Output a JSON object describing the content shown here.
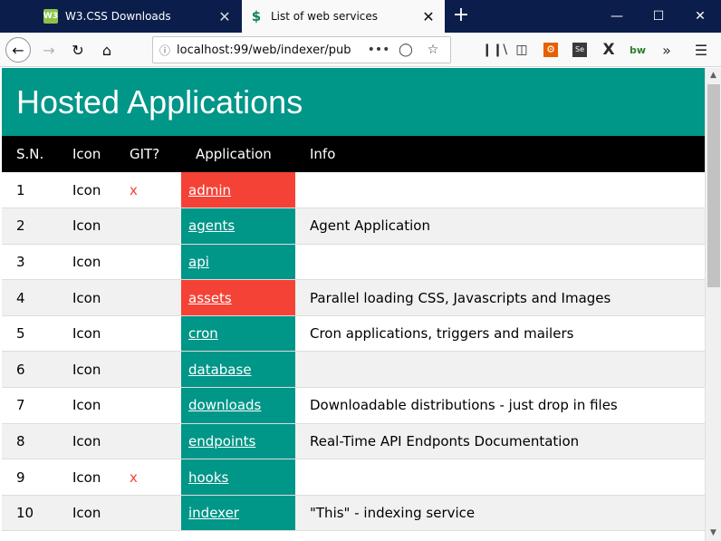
{
  "tabs": [
    {
      "title": "W3.CSS Downloads",
      "icon": "w3css-favicon-icon",
      "icon_text": "W3"
    },
    {
      "title": "List of web services",
      "icon": "dollar-favicon-icon",
      "icon_text": "$"
    }
  ],
  "address_bar": {
    "url": "localhost:99/web/indexer/pub"
  },
  "page": {
    "title": "Hosted Applications"
  },
  "table": {
    "headers": {
      "sn": "S.N.",
      "icon": "Icon",
      "git": "GIT?",
      "app": "Application",
      "info": "Info"
    },
    "rows": [
      {
        "sn": "1",
        "icon": "Icon",
        "git": "x",
        "app": "admin",
        "info": "",
        "status": "red"
      },
      {
        "sn": "2",
        "icon": "Icon",
        "git": "",
        "app": "agents",
        "info": "Agent Application",
        "status": "teal"
      },
      {
        "sn": "3",
        "icon": "Icon",
        "git": "",
        "app": "api",
        "info": "",
        "status": "teal"
      },
      {
        "sn": "4",
        "icon": "Icon",
        "git": "",
        "app": "assets",
        "info": "Parallel loading CSS, Javascripts and Images",
        "status": "red"
      },
      {
        "sn": "5",
        "icon": "Icon",
        "git": "",
        "app": "cron",
        "info": "Cron applications, triggers and mailers",
        "status": "teal"
      },
      {
        "sn": "6",
        "icon": "Icon",
        "git": "",
        "app": "database",
        "info": "",
        "status": "teal"
      },
      {
        "sn": "7",
        "icon": "Icon",
        "git": "",
        "app": "downloads",
        "info": "Downloadable distributions - just drop in files",
        "status": "teal"
      },
      {
        "sn": "8",
        "icon": "Icon",
        "git": "",
        "app": "endpoints",
        "info": "Real-Time API Endponts Documentation",
        "status": "teal"
      },
      {
        "sn": "9",
        "icon": "Icon",
        "git": "x",
        "app": "hooks",
        "info": "",
        "status": "teal"
      },
      {
        "sn": "10",
        "icon": "Icon",
        "git": "",
        "app": "indexer",
        "info": "\"This\" - indexing service",
        "status": "teal"
      }
    ]
  },
  "colors": {
    "header": "#009688",
    "app_ok": "#009688",
    "app_alert": "#f44336",
    "titlebar": "#0b1e4b"
  }
}
